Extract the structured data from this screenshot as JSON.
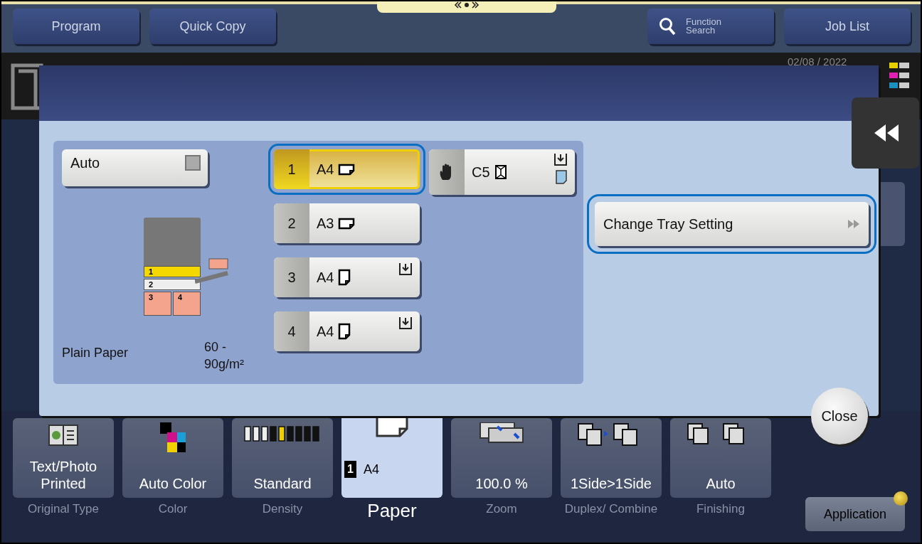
{
  "top_bar": {
    "buttons": [
      {
        "kind": "plain",
        "label": "Program"
      },
      {
        "kind": "plain",
        "label": "Quick Copy"
      },
      {
        "kind": "search",
        "label": "Function Search"
      },
      {
        "kind": "plain",
        "label": "Job List"
      }
    ]
  },
  "status": {
    "date": "02/08 / 2022"
  },
  "dialog": {
    "auto": {
      "label": "Auto",
      "checked": false
    },
    "diagram": {
      "trays": [
        {
          "label": "1",
          "color": "#f5d800"
        },
        {
          "label": "2",
          "color": "#eeeeee"
        },
        {
          "label": "3",
          "color": "#f4a48c"
        },
        {
          "label": "4",
          "color": "#f4a48c"
        }
      ]
    },
    "paper_type": "Plain Paper",
    "weight": "60 - 90g/m²",
    "trays": [
      {
        "number": "1",
        "size": "A4",
        "kind": "landscape",
        "selected": true,
        "feed_mark": false
      },
      {
        "number": "2",
        "size": "A3",
        "kind": "landscape",
        "selected": false,
        "feed_mark": false
      },
      {
        "number": "3",
        "size": "A4",
        "kind": "portrait",
        "selected": false,
        "feed_mark": true
      },
      {
        "number": "4",
        "size": "A4",
        "kind": "portrait",
        "selected": false,
        "feed_mark": true
      }
    ],
    "bypass": {
      "size": "C5",
      "selected": false
    },
    "action": "Change Tray Setting",
    "close": "Close"
  },
  "functions": [
    {
      "kind": "original",
      "value": "Text/Photo Printed",
      "label": "Original Type",
      "selected": false
    },
    {
      "kind": "color",
      "value": "Auto Color",
      "label": "Color",
      "selected": false
    },
    {
      "kind": "density",
      "value": "Standard",
      "label": "Density",
      "selected": false
    },
    {
      "kind": "paper",
      "badge": "1",
      "value": "A4",
      "label": "Paper",
      "selected": true
    },
    {
      "kind": "zoom",
      "value": "100.0 %",
      "label": "Zoom",
      "selected": false
    },
    {
      "kind": "duplex",
      "value": "1Side>1Side",
      "label": "Duplex/ Combine",
      "selected": false
    },
    {
      "kind": "finishing",
      "value": "Auto",
      "label": "Finishing",
      "selected": false
    }
  ],
  "application": "Application"
}
